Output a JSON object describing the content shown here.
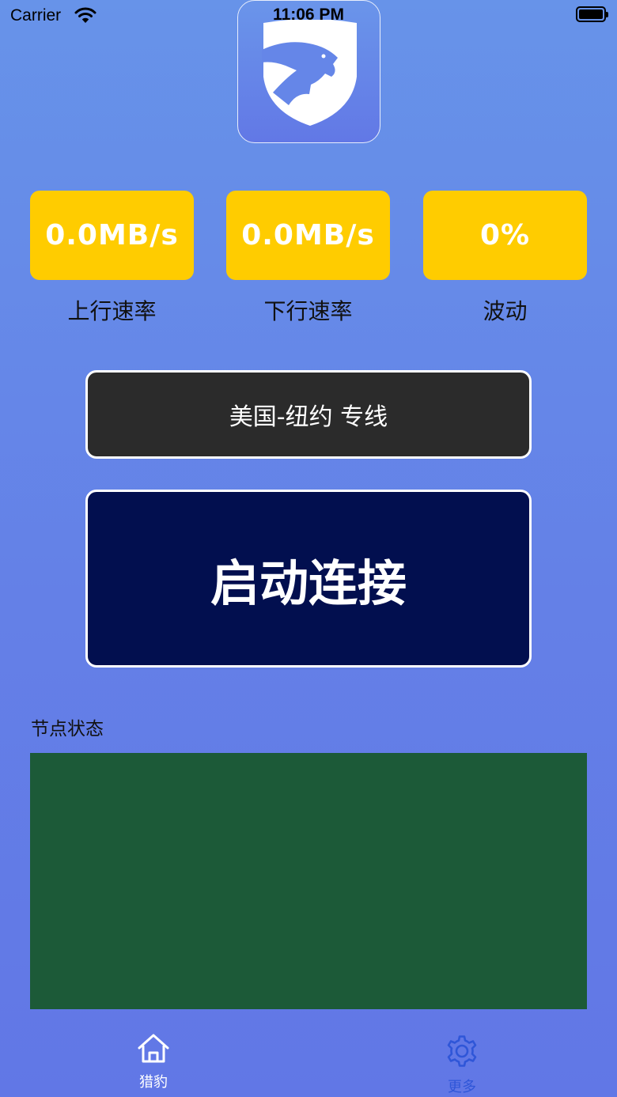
{
  "status_bar": {
    "carrier": "Carrier",
    "time": "11:06 PM"
  },
  "app": {
    "logo_icon": "panther-shield-icon"
  },
  "stats": [
    {
      "value": "0.0MB/s",
      "label": "上行速率"
    },
    {
      "value": "0.0MB/s",
      "label": "下行速率"
    },
    {
      "value": "0%",
      "label": "波动"
    }
  ],
  "route": {
    "label": "美国-纽约 专线"
  },
  "connect": {
    "label": "启动连接"
  },
  "node_status": {
    "title": "节点状态"
  },
  "tabs": [
    {
      "label": "猎豹",
      "icon": "home-icon",
      "active": true
    },
    {
      "label": "更多",
      "icon": "gear-icon",
      "active": false
    }
  ],
  "colors": {
    "stat_card": "#ffcc00",
    "route_button": "#2b2b2b",
    "connect_button": "#020f4f",
    "node_panel": "#1c5a38",
    "tab_active": "#ffffff",
    "tab_inactive": "#2f56d8"
  }
}
